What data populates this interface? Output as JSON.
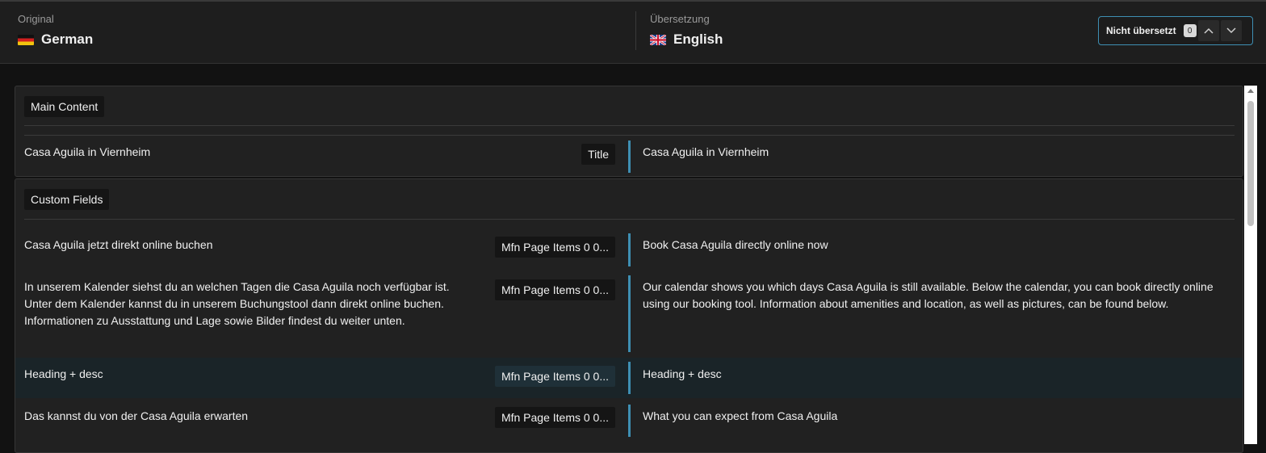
{
  "header": {
    "original_caption": "Original",
    "original_language": "German",
    "original_flag": "flag-de-icon",
    "translation_caption": "Übersetzung",
    "translation_language": "English",
    "translation_flag": "flag-gb-icon",
    "filter_label": "Nicht übersetzt",
    "filter_count": "0",
    "prev_icon": "chevron-up-icon",
    "next_icon": "chevron-down-icon"
  },
  "colors": {
    "accent": "#3e8fb3",
    "background": "#121212",
    "panel": "#212121"
  },
  "main_content": {
    "section_label": "Main Content",
    "rows": [
      {
        "source": "Casa Aguila in Viernheim",
        "field": "Title",
        "target": "Casa Aguila in Viernheim"
      }
    ]
  },
  "custom_fields": {
    "section_label": "Custom Fields",
    "rows": [
      {
        "source": "Casa Aguila jetzt direkt online buchen",
        "field": "Mfn Page Items 0 0...",
        "target": "Book Casa Aguila directly online now"
      },
      {
        "source": "In unserem Kalender siehst du an welchen Tagen die Casa Aguila noch verfügbar ist. Unter dem Kalender kannst du in unserem Buchungstool dann direkt online buchen. Informationen zu Ausstattung und Lage sowie Bilder findest du weiter unten.",
        "field": "Mfn Page Items 0 0...",
        "target": "Our calendar shows you which days Casa Aguila is still available. Below the calendar, you can book directly online using our booking tool. Information about amenities and location, as well as pictures, can be found below."
      },
      {
        "source": "Heading + desc",
        "field": "Mfn Page Items 0 0...",
        "target": "Heading + desc"
      },
      {
        "source": "Das kannst du von der Casa Aguila erwarten",
        "field": "Mfn Page Items 0 0...",
        "target": "What you can expect from Casa Aguila"
      }
    ]
  }
}
